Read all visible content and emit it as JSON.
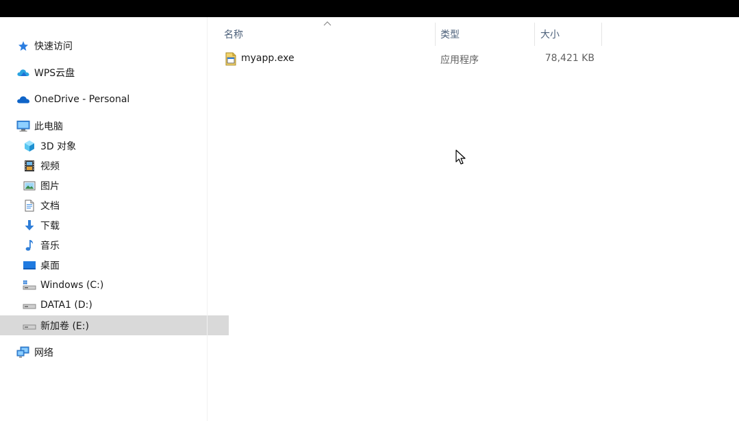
{
  "sidebar": {
    "quick_access": "快速访问",
    "wps_cloud": "WPS云盘",
    "onedrive": "OneDrive - Personal",
    "this_pc": "此电脑",
    "objects3d": "3D 对象",
    "videos": "视频",
    "pictures": "图片",
    "documents": "文档",
    "downloads": "下载",
    "music": "音乐",
    "desktop": "桌面",
    "drive_c": "Windows (C:)",
    "drive_d": "DATA1 (D:)",
    "drive_e": "新加卷 (E:)",
    "network": "网络"
  },
  "columns": {
    "name": "名称",
    "type": "类型",
    "size": "大小"
  },
  "files": [
    {
      "name": "myapp.exe",
      "type": "应用程序",
      "size": "78,421 KB"
    }
  ],
  "colors": {
    "selected": "#d9d9d9",
    "header_text": "#4c607a",
    "accent_blue": "#1e73d8"
  }
}
